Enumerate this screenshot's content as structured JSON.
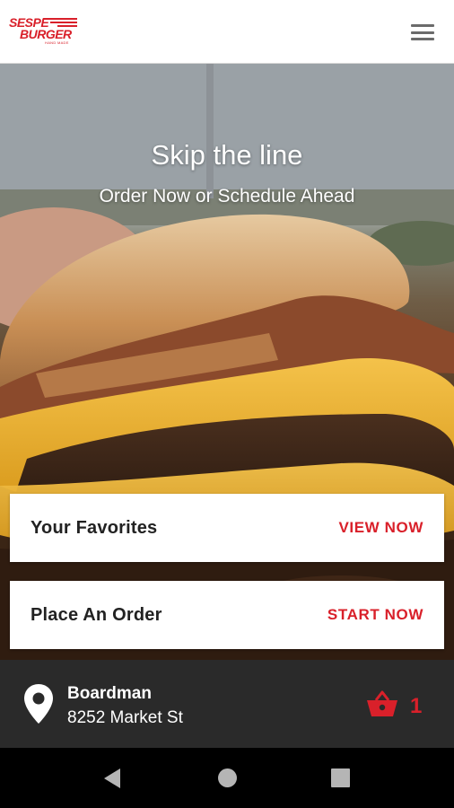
{
  "header": {
    "logo_top": "SESPE",
    "logo_bottom": "BURGER",
    "logo_tag": "HAND MADE",
    "menu_icon": "hamburger-menu-icon"
  },
  "hero": {
    "title": "Skip the line",
    "subtitle": "Order Now or Schedule Ahead"
  },
  "cards": {
    "favorites": {
      "title": "Your Favorites",
      "action": "VIEW NOW"
    },
    "order": {
      "title": "Place An Order",
      "action": "START NOW"
    }
  },
  "location": {
    "icon": "map-pin-icon",
    "name": "Boardman",
    "address": "8252 Market St",
    "cart_icon": "basket-icon",
    "cart_count": "1"
  },
  "system_nav": {
    "back_icon": "back-icon",
    "home_icon": "home-icon",
    "recents_icon": "recents-icon"
  },
  "colors": {
    "brand_red": "#d9202a",
    "bottom_bar": "#2a2a2a",
    "card_bg": "#ffffff"
  }
}
